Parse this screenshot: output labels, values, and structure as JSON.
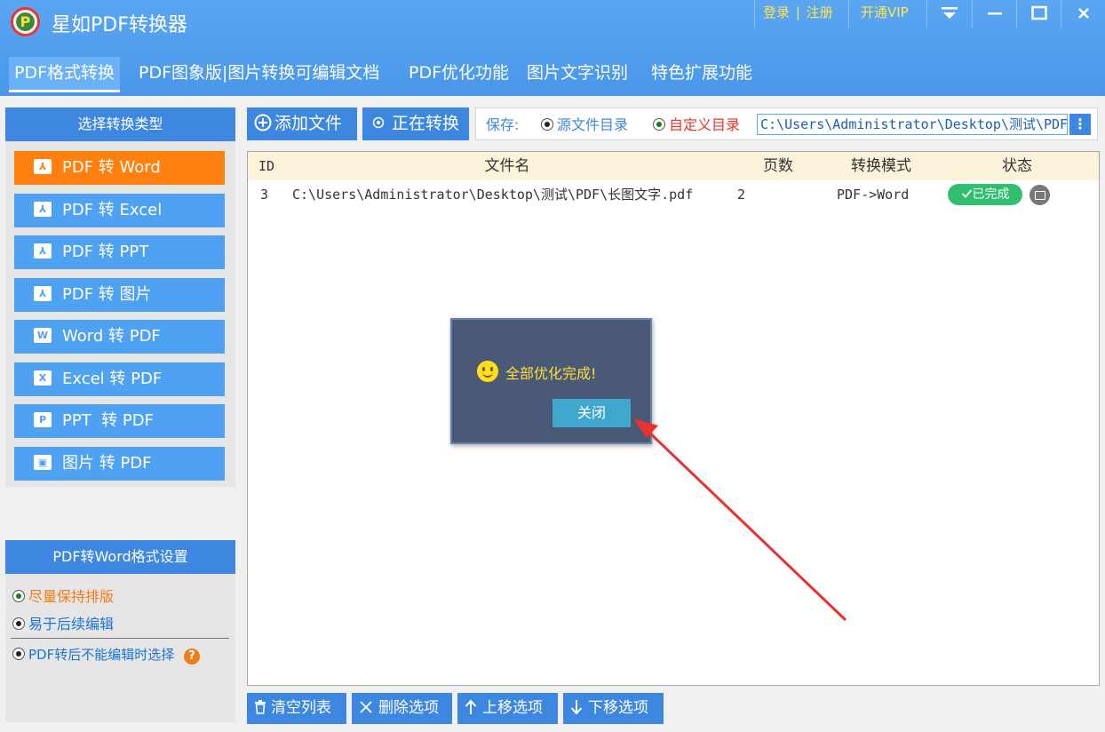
{
  "app": {
    "title": "星如PDF转换器"
  },
  "topbar": {
    "login": "登录",
    "separator": "|",
    "register": "注册",
    "vip": "开通VIP"
  },
  "menu": {
    "tabs": [
      {
        "label": "PDF格式转换",
        "active": true
      },
      {
        "label": "PDF图象版|图片转换可编辑文档"
      },
      {
        "label": "PDF优化功能"
      },
      {
        "label": "图片文字识别"
      },
      {
        "label": "特色扩展功能"
      }
    ]
  },
  "left_panel": {
    "header": "选择转换类型",
    "items": [
      {
        "label": "PDF 转 Word",
        "icon": "pdf-icon",
        "icon_text": "⅄",
        "active": true
      },
      {
        "label": "PDF 转 Excel",
        "icon": "pdf-icon",
        "icon_text": "⅄"
      },
      {
        "label": "PDF 转 PPT",
        "icon": "pdf-icon",
        "icon_text": "⅄"
      },
      {
        "label": "PDF 转 图片",
        "icon": "pdf-icon",
        "icon_text": "⅄"
      },
      {
        "label": "Word 转 PDF",
        "icon": "word-icon",
        "icon_text": "W"
      },
      {
        "label": "Excel 转 PDF",
        "icon": "excel-icon",
        "icon_text": "X"
      },
      {
        "label": "PPT  转 PDF",
        "icon": "ppt-icon",
        "icon_text": "P"
      },
      {
        "label": "图片 转 PDF",
        "icon": "image-icon",
        "icon_text": "▣"
      }
    ]
  },
  "settings": {
    "header": "PDF转Word格式设置",
    "options": [
      {
        "label": "尽量保持排版",
        "selected": true
      },
      {
        "label": "易于后续编辑"
      }
    ],
    "extra_option": "PDF转后不能编辑时选择",
    "help": "?"
  },
  "toolbar": {
    "add_file": "添加文件",
    "converting": "正在转换",
    "save_label": "保存:",
    "save_source": "源文件目录",
    "save_custom": "自定义目录",
    "save_path": "C:\\Users\\Administrator\\Desktop\\测试\\PDF",
    "more": "⋮"
  },
  "file_table": {
    "columns": [
      "ID",
      "文件名",
      "页数",
      "转换模式",
      "状态"
    ],
    "rows": [
      {
        "id": "3",
        "filename": "C:\\Users\\Administrator\\Desktop\\测试\\PDF\\长图文字.pdf",
        "pages": "2",
        "mode": "PDF->Word",
        "status": "已完成"
      }
    ]
  },
  "dialog": {
    "message": "全部优化完成!",
    "close_label": "关闭"
  },
  "bottom_bar": {
    "clear": "清空列表",
    "delete": "删除选项",
    "move_up": "上移选项",
    "move_down": "下移选项"
  },
  "colors": {
    "header_blue": "#4a97ea",
    "accent_orange": "#ff7f0f",
    "button_blue": "#3d87e0",
    "done_green": "#2fbf6f",
    "annotation_red": "#e8322f"
  }
}
